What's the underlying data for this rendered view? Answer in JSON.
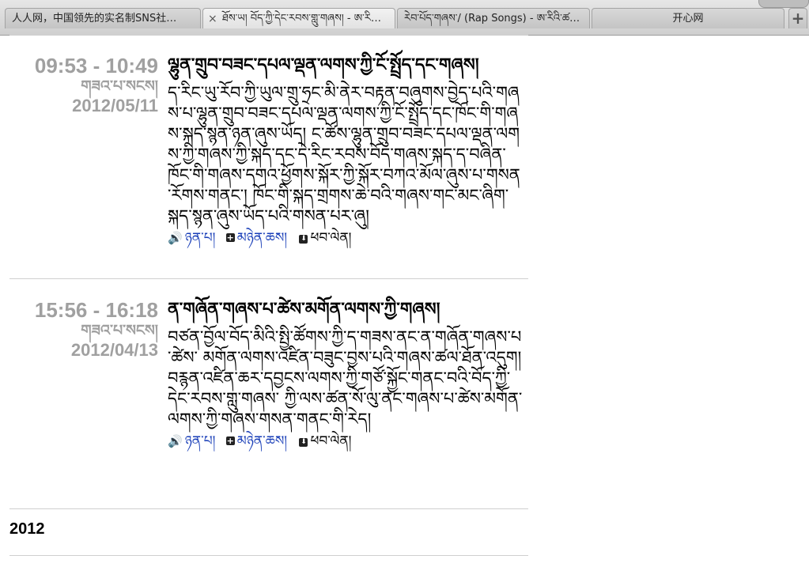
{
  "tabs": [
    {
      "label": "人人网，中国领先的实名制SNS社…"
    },
    {
      "label": "ཐོས་ཡ། བོད་ཀྱི་དེང་རབས་གླུ་གཞས། - ཨ་རི…"
    },
    {
      "label": "རེབ་པོད་གཞས་/ (Rap Songs) - ཨ་རིའི་ཚ…"
    },
    {
      "label": "开心网"
    }
  ],
  "new_tab_symbol": "+",
  "close_symbol": "×",
  "entries": [
    {
      "time_range": "09:53  -  10:49",
      "day_label": "གཟའ་པ་སངས།",
      "date": "2012/05/11",
      "title": "ལྷུན་གྲུབ་བཟང་དཔལ་ལྡན་ལགས་ཀྱི་ངོ་སྤྲོད་དང་གཞས།",
      "body": "ད་རིང་ཡུ་རོབ་ཀྱི་ཡུལ་གྲུ་ཧྲང་མི་ནེར་བརྟན་བཞུགས་བྱེད་པའི་གཞས་པ་ལྷུན་གྲུབ་བཟང་དཔལ་ལྡན་ལགས་ཀྱི་ངོ་སྤྲོད་དང་ཁོང་གི་གཞས་སྐད་སྙན་ཉན་ཞུས་ཡོད། ང་ཚོས་ལྷུན་གྲུབ་བཟང་དཔལ་ལྡན་ལགས་ཀྱི་གཞས་ཀྱི་སྐད་དང་དེ་རིང་རབས་བོད་གཞས་སྐད་ད་བཞིན་ཁོང་གི་གཞས་དགའ་ཕྱོགས་སྐོར་ཀྱི་སྐོར་བཀའ་མོལ་ཞུས་པ་གསན་རོགས་གནང་། ཁོང་གི་སྐད་གྲགས་ཆེ་བའི་གཞས་གང་མང་ཞིག་སྐད་སྙན་ཞུས་ཡོད་པའི་གསན་པར་ཞུ།",
      "actions": {
        "listen": "ཉན་པ།",
        "subscribe": "མཉེན་ཆས།",
        "download": "ཕབ་ལེན།"
      }
    },
    {
      "time_range": "15:56  -  16:18",
      "day_label": "གཟའ་པ་སངས།",
      "date": "2012/04/13",
      "title": "ན་གཞོན་གཞས་པ་ཚེས་མགོན་ལགས་ཀྱི་གཞས།",
      "body": "བཙན་བྱོལ་བོད་མིའི་སྤྱི་ཚོགས་ཀྱི་ད་གཟས་ནང་ན་གཞོན་གཞས་པ་ཚེས་ མགོན་ལགས་འཛིན་བཟུང་བྱས་པའི་གཞས་ཚལ་ཐོན་འདུག། བརྙན་འཛིན་ཆར་དབྱངས་ལགས་ཀྱི་གཙོ་སྐྱོང་གནང་བའི་བོད་ཀྱི་དེང་རབས་གླུ་གཞས་ ཀྱི་ལས་ཚན་སོ་ལུ་ནང་གཞས་པ་ཚེས་མགོན་ལགས་ཀྱི་གཞས་གསན་གནང་གི་རེད།",
      "actions": {
        "listen": "ཉན་པ།",
        "subscribe": "མཉེན་ཆས།",
        "download": "ཕབ་ལེན།"
      }
    }
  ],
  "year_header": "2012",
  "icons": {
    "speaker": "speaker-icon",
    "plus": "plus-icon",
    "download": "download-icon"
  }
}
